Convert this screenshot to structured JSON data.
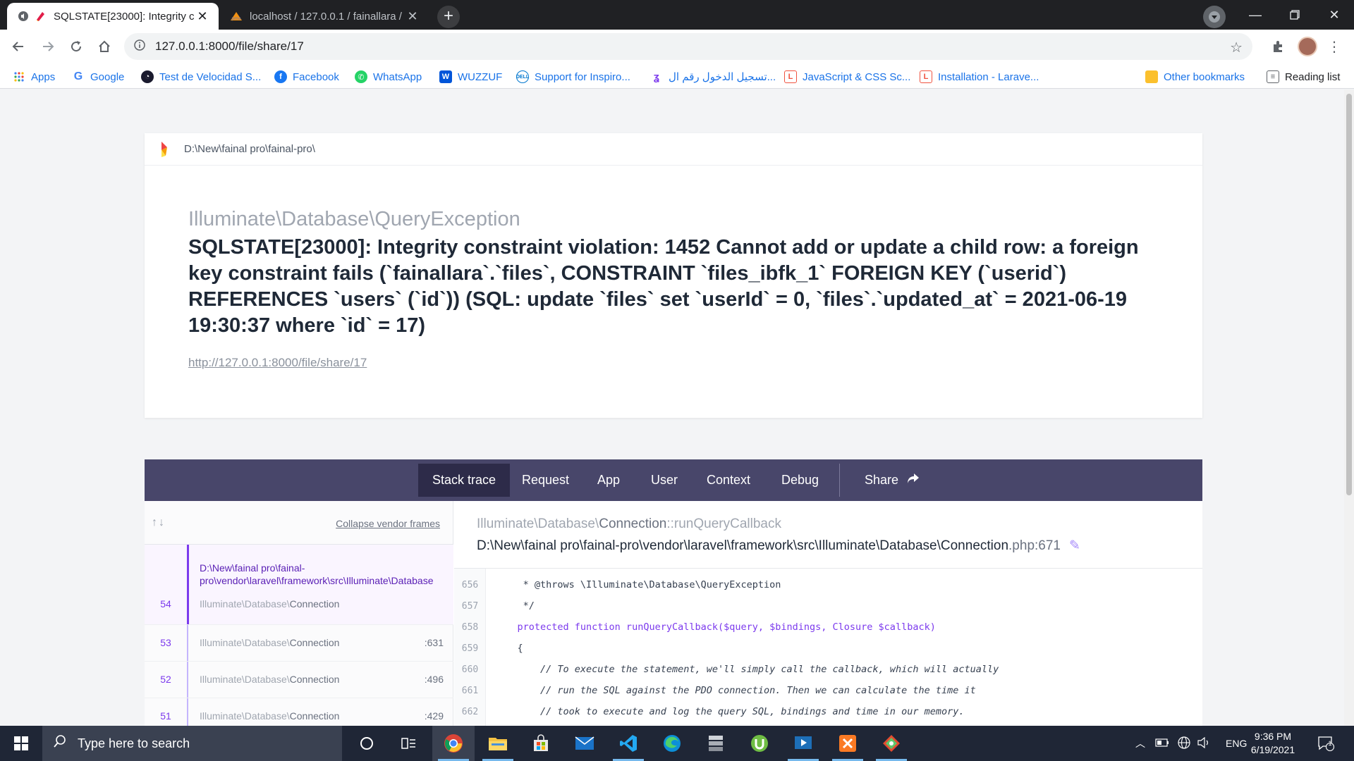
{
  "browser": {
    "tabs": [
      {
        "title": "SQLSTATE[23000]: Integrity c"
      },
      {
        "title": "localhost / 127.0.0.1 / fainallara /"
      }
    ],
    "url": "127.0.0.1:8000/file/share/17",
    "bookmarks": [
      {
        "label": "Apps",
        "icon": "apps-grid-icon"
      },
      {
        "label": "Google",
        "icon": "google-icon"
      },
      {
        "label": "Test de Velocidad S...",
        "icon": "speedtest-icon"
      },
      {
        "label": "Facebook",
        "icon": "facebook-icon"
      },
      {
        "label": "WhatsApp",
        "icon": "whatsapp-icon"
      },
      {
        "label": "WUZZUF",
        "icon": "wuzzuf-icon"
      },
      {
        "label": "Support for Inspiro...",
        "icon": "dell-icon"
      },
      {
        "label": "تسجيل الدخول رقم ال...",
        "icon": "login-icon"
      },
      {
        "label": "JavaScript & CSS Sc...",
        "icon": "laravel-icon"
      },
      {
        "label": "Installation - Larave...",
        "icon": "laravel-icon"
      }
    ],
    "other_bookmarks": "Other bookmarks",
    "reading_list": "Reading list"
  },
  "error_page": {
    "project_path": "D:\\New\\fainal pro\\fainal-pro\\",
    "exception_class": "Illuminate\\Database\\QueryException",
    "message": "SQLSTATE[23000]: Integrity constraint violation: 1452 Cannot add or update a child row: a foreign key constraint fails (`fainallara`.`files`, CONSTRAINT `files_ibfk_1` FOREIGN KEY (`userid`) REFERENCES `users` (`id`)) (SQL: update `files` set `userId` = 0, `files`.`updated_at` = 2021-06-19 19:30:37 where `id` = 17)",
    "url": "http://127.0.0.1:8000/file/share/17",
    "tabs": [
      "Stack trace",
      "Request",
      "App",
      "User",
      "Context",
      "Debug"
    ],
    "share_label": "Share",
    "collapse_vendor": "Collapse vendor frames",
    "frames": [
      {
        "number": "54",
        "path": "D:\\New\\fainal pro\\fainal-pro\\vendor\\laravel\\framework\\src\\Illuminate\\Database",
        "namespace": "Illuminate\\Database\\",
        "class": "Connection",
        "line": ""
      },
      {
        "number": "53",
        "namespace": "Illuminate\\Database\\",
        "class": "Connection",
        "line": ":631"
      },
      {
        "number": "52",
        "namespace": "Illuminate\\Database\\",
        "class": "Connection",
        "line": ":496"
      },
      {
        "number": "51",
        "namespace": "Illuminate\\Database\\",
        "class": "Connection",
        "line": ":429"
      }
    ],
    "selected": {
      "namespace": "Illuminate\\Database\\",
      "class": "Connection",
      "method": "::runQueryCallback",
      "file": "D:\\New\\fainal pro\\fainal-pro\\vendor\\laravel\\framework\\src\\Illuminate\\Database\\Connection",
      "ext_line": ".php:671"
    },
    "code": [
      {
        "n": "656",
        "text": "     * @throws \\Illuminate\\Database\\QueryException"
      },
      {
        "n": "657",
        "text": "     */"
      },
      {
        "n": "658",
        "text": "    protected function runQueryCallback($query, $bindings, Closure $callback)"
      },
      {
        "n": "659",
        "text": "    {"
      },
      {
        "n": "660",
        "text": "        // To execute the statement, we'll simply call the callback, which will actually"
      },
      {
        "n": "661",
        "text": "        // run the SQL against the PDO connection. Then we can calculate the time it"
      },
      {
        "n": "662",
        "text": "        // took to execute and log the query SQL, bindings and time in our memory."
      }
    ]
  },
  "taskbar": {
    "search_placeholder": "Type here to search",
    "language": "ENG",
    "time": "9:36 PM",
    "date": "6/19/2021",
    "notification_count": "1"
  },
  "colors": {
    "accent": "#7c3aed",
    "nav_bg": "#48466a",
    "nav_active": "#2d2b49"
  }
}
